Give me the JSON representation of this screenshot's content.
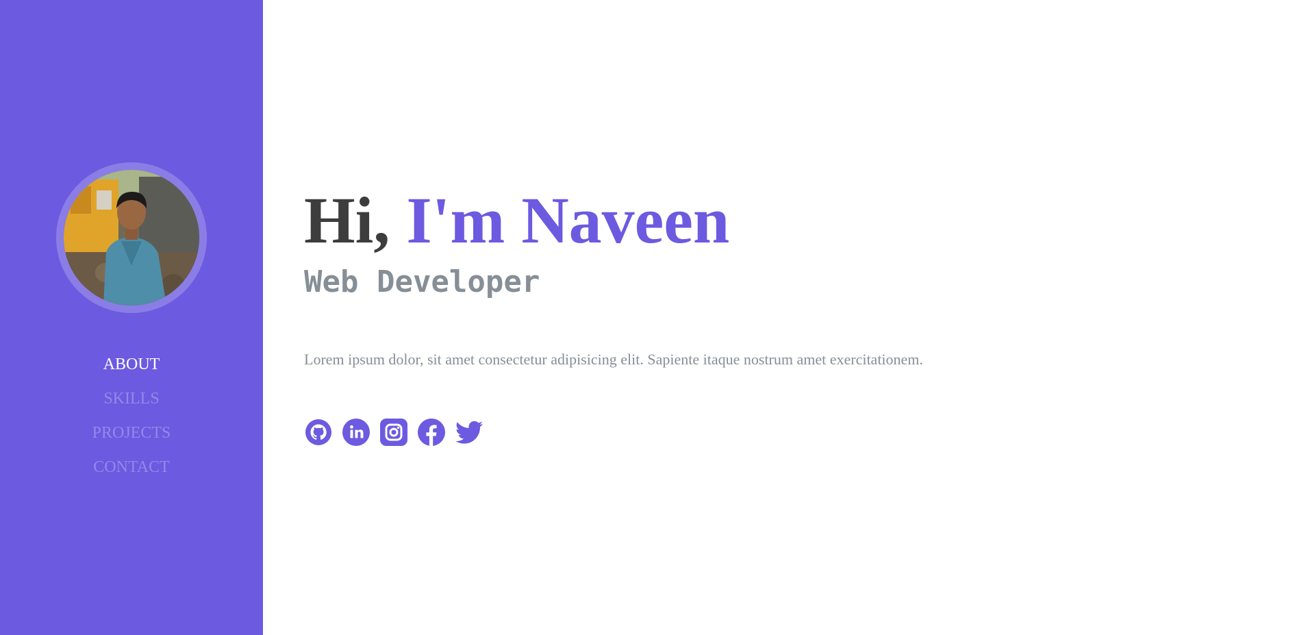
{
  "sidebar": {
    "profile_photo": "profile-photo",
    "nav": [
      {
        "label": "ABOUT",
        "active": true
      },
      {
        "label": "SKILLS",
        "active": false
      },
      {
        "label": "PROJECTS",
        "active": false
      },
      {
        "label": "CONTACT",
        "active": false
      }
    ]
  },
  "hero": {
    "greeting": "Hi, ",
    "name": "I'm Naveen",
    "role": "Web Developer",
    "description": "Lorem ipsum dolor, sit amet consectetur adipisicing elit. Sapiente itaque nostrum amet exercitationem."
  },
  "socials": [
    {
      "icon": "github-icon"
    },
    {
      "icon": "linkedin-icon"
    },
    {
      "icon": "instagram-icon"
    },
    {
      "icon": "facebook-icon"
    },
    {
      "icon": "twitter-icon"
    }
  ],
  "colors": {
    "accent": "#6c5ae0",
    "heading": "#3d3d3d",
    "muted": "#868e96",
    "nav_active": "#ffffff"
  }
}
